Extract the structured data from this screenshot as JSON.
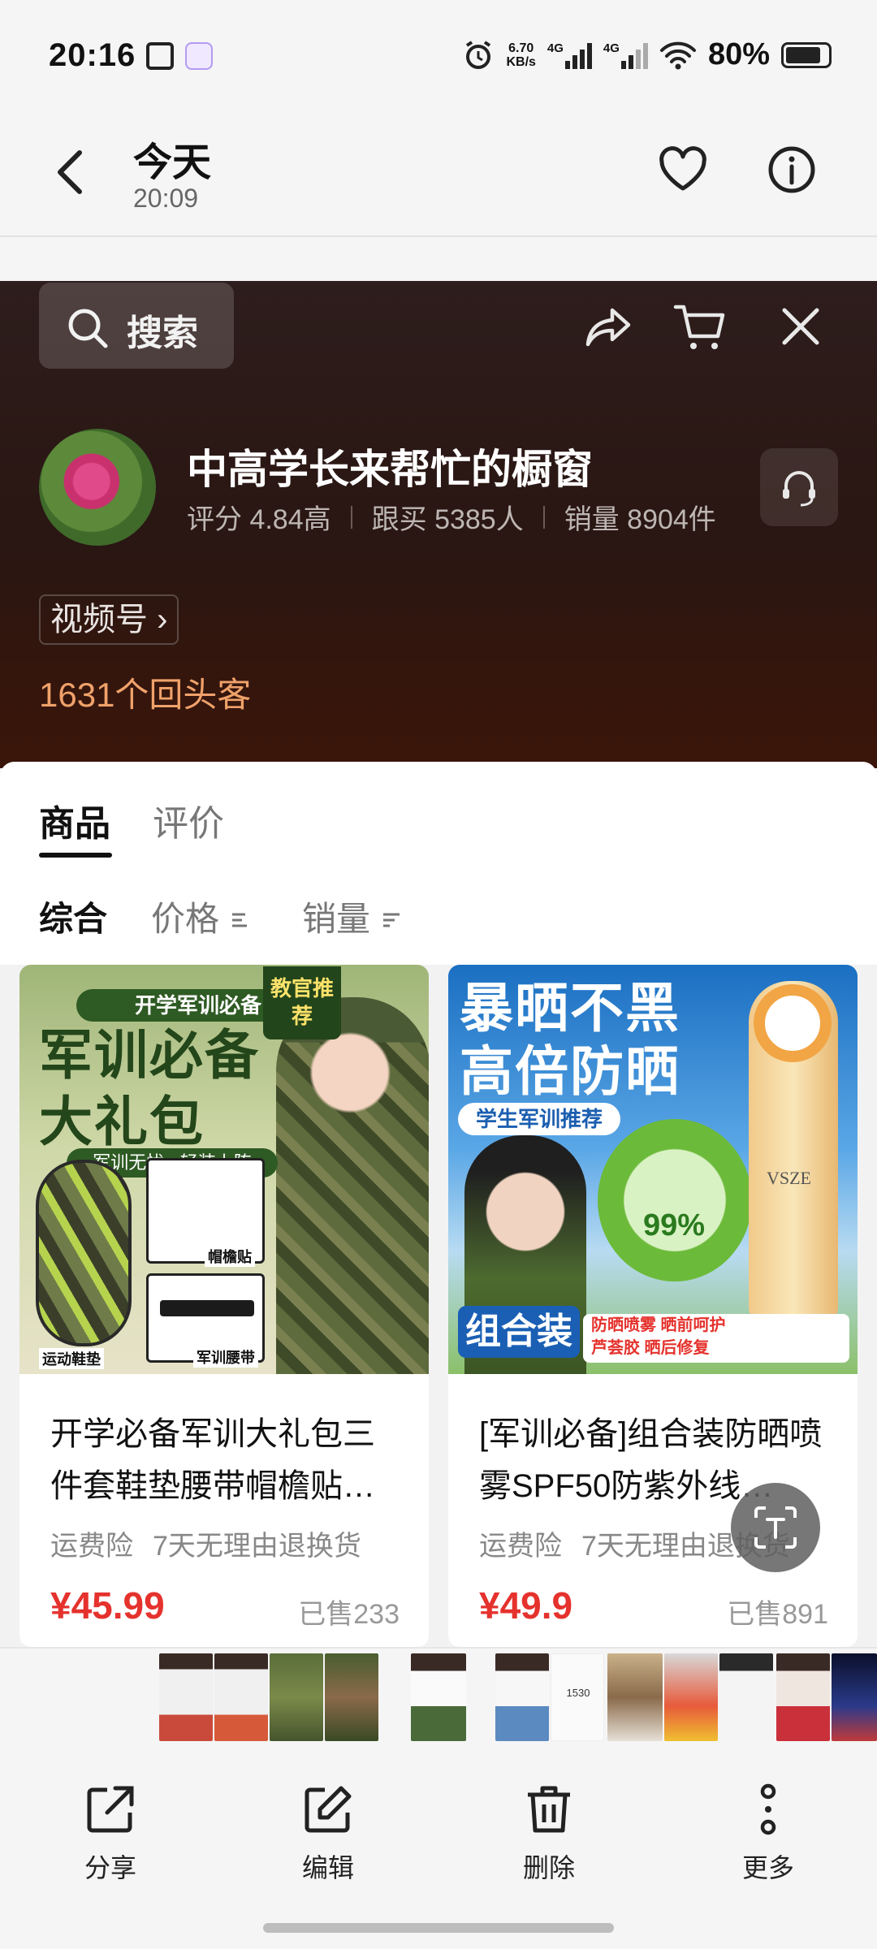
{
  "status_bar": {
    "time": "20:16",
    "speed_value": "6.70",
    "speed_unit": "KB/s",
    "network1": "4G",
    "network2": "4G",
    "battery": "80%"
  },
  "header": {
    "title": "今天",
    "subtitle": "20:09"
  },
  "store": {
    "search_label": "搜索",
    "name": "中高学长来帮忙的橱窗",
    "rating": "评分 4.84高",
    "followers": "跟买 5385人",
    "sales": "销量 8904件",
    "channel_link": "视频号",
    "returning_customers": "1631个回头客"
  },
  "tabs": [
    {
      "label": "商品",
      "active": true
    },
    {
      "label": "评价",
      "active": false
    }
  ],
  "sort_options": [
    {
      "label": "综合"
    },
    {
      "label": "价格"
    },
    {
      "label": "销量"
    }
  ],
  "products": [
    {
      "title": "开学必备军训大礼包三件套鞋垫腰带帽檐贴…",
      "tags": [
        "运费险",
        "7天无理由退换货"
      ],
      "price": "¥45.99",
      "sold": "已售233",
      "image_text": {
        "kicker": "开学军训必备",
        "headline_line1": "军训必备",
        "headline_line2": "大礼包",
        "badge": "教官推荐",
        "subline": "军训无忧 · 轻装上阵",
        "label_insole": "运动鞋垫",
        "label_cap": "帽檐贴",
        "label_belt": "军训腰带"
      }
    },
    {
      "title": "[军训必备]组合装防晒喷雾SPF50防紫外线…",
      "tags": [
        "运费险",
        "7天无理由退换货"
      ],
      "price": "¥49.9",
      "sold": "已售891",
      "image_text": {
        "headline_line1": "暴晒不黑",
        "headline_line2": "高倍防晒",
        "subline": "学生军训推荐",
        "combo": "组合装",
        "strip_line1": "防晒喷雾 晒前呵护",
        "strip_line2": "芦荟胶 晒后修复",
        "brand": "VSZE",
        "aloe_percent": "99%"
      }
    }
  ],
  "thumbnail_counter": "1530",
  "actions": [
    {
      "label": "分享"
    },
    {
      "label": "编辑"
    },
    {
      "label": "删除"
    },
    {
      "label": "更多"
    }
  ],
  "colors": {
    "accent_price": "#e5322d",
    "returning": "#f0a26a",
    "store_bg": "#2a1612"
  }
}
